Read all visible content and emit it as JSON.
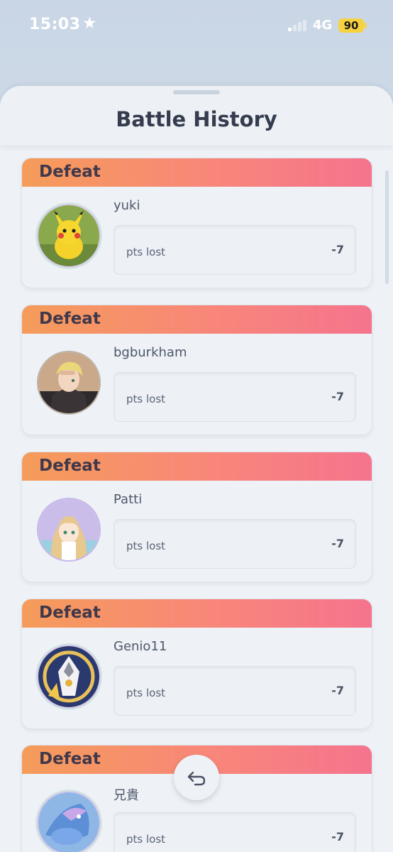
{
  "status_bar": {
    "time": "15:03",
    "network": "4G",
    "battery": "90"
  },
  "sheet": {
    "title": "Battle History"
  },
  "battles": [
    {
      "result": "Defeat",
      "opponent": "yuki",
      "pts_label": "pts lost",
      "pts_value": "-7",
      "avatar": "pikachu"
    },
    {
      "result": "Defeat",
      "opponent": "bgburkham",
      "pts_label": "pts lost",
      "pts_value": "-7",
      "avatar": "blond-trainer"
    },
    {
      "result": "Defeat",
      "opponent": "Patti",
      "pts_label": "pts lost",
      "pts_value": "-7",
      "avatar": "long-hair-trainer"
    },
    {
      "result": "Defeat",
      "opponent": "Genio11",
      "pts_label": "pts lost",
      "pts_value": "-7",
      "avatar": "arceus"
    },
    {
      "result": "Defeat",
      "opponent": "兄貴",
      "pts_label": "pts lost",
      "pts_value": "-7",
      "avatar": "suicune"
    }
  ],
  "colors": {
    "header_start": "#f59c5a",
    "header_end": "#f5748d",
    "background": "#eef2f7",
    "title": "#343c4e"
  },
  "icons": {
    "back": "return-arrow-icon",
    "star": "star-icon"
  }
}
